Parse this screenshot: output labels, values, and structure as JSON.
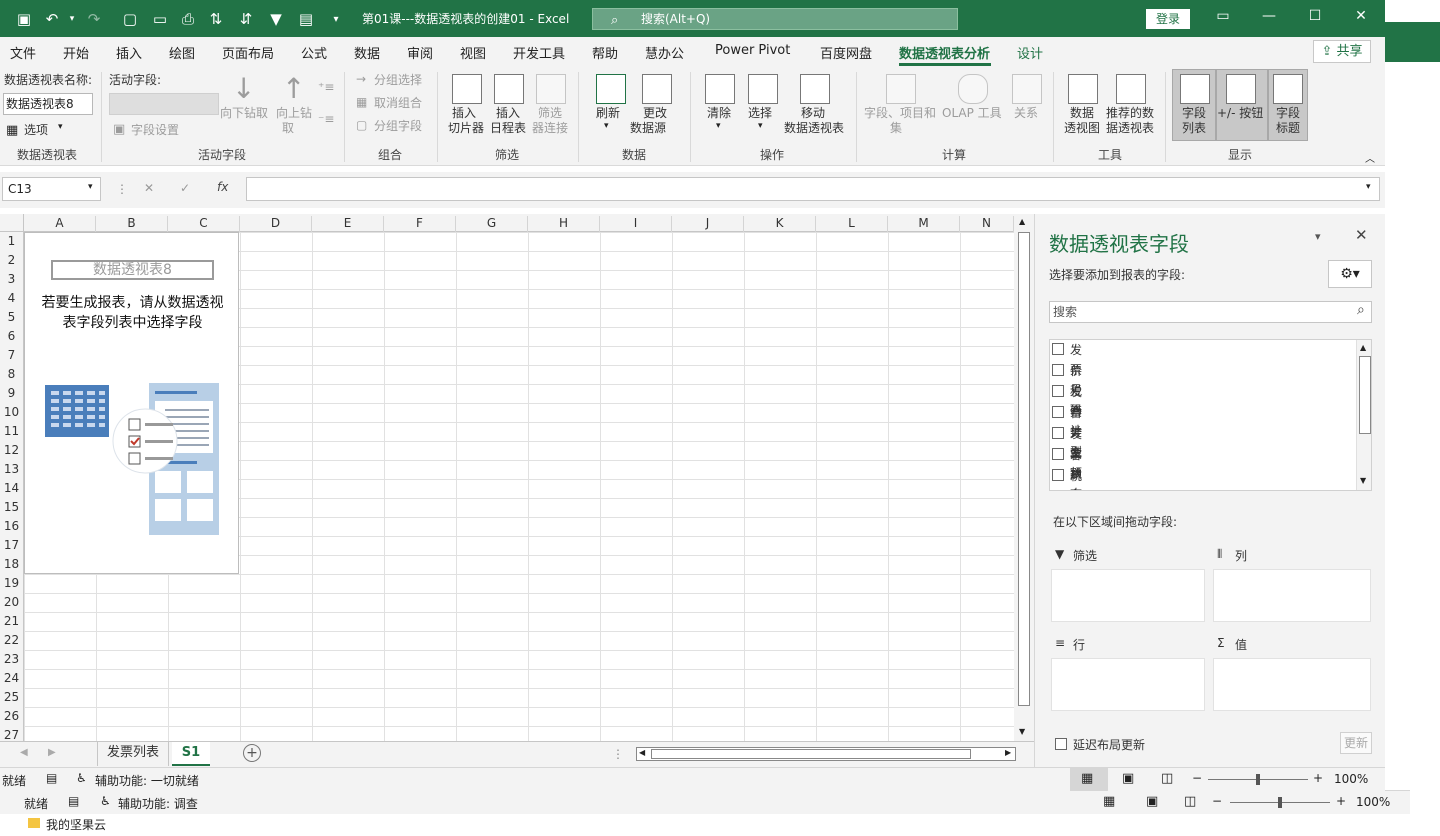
{
  "titlebar": {
    "doc_title": "第01课---数据透视表的创建01  -  Excel",
    "search_placeholder": "搜索(Alt+Q)",
    "login": "登录"
  },
  "menu": {
    "items": [
      "文件",
      "开始",
      "插入",
      "绘图",
      "页面布局",
      "公式",
      "数据",
      "审阅",
      "视图",
      "开发工具",
      "帮助",
      "慧办公",
      "Power Pivot",
      "百度网盘",
      "数据透视表分析",
      "设计"
    ],
    "active": "数据透视表分析",
    "share": "共享"
  },
  "ribbon": {
    "pivot_name_label": "数据透视表名称:",
    "pivot_name_value": "数据透视表8",
    "options": "选项",
    "group_pivot": "数据透视表",
    "active_field_label": "活动字段:",
    "field_settings": "字段设置",
    "drill_down": "向下钻取",
    "drill_up_1": "向上钻",
    "drill_up_2": "取",
    "group_active": "活动字段",
    "group_selection": "分组选择",
    "ungroup": "取消组合",
    "group_field": "分组字段",
    "group_group": "组合",
    "insert_slicer_1": "插入",
    "insert_slicer_2": "切片器",
    "insert_timeline_1": "插入",
    "insert_timeline_2": "日程表",
    "filter_conn_1": "筛选",
    "filter_conn_2": "器连接",
    "group_filter": "筛选",
    "refresh": "刷新",
    "change_src_1": "更改",
    "change_src_2": "数据源",
    "group_data": "数据",
    "clear": "清除",
    "select": "选择",
    "move_1": "移动",
    "move_2": "数据透视表",
    "group_actions": "操作",
    "fields_items_1": "字段、项目和",
    "fields_items_2": "集",
    "olap_1": "OLAP 工具",
    "relations": "关系",
    "group_calc": "计算",
    "pivot_chart_1": "数据",
    "pivot_chart_2": "透视图",
    "recommend_1": "推荐的数",
    "recommend_2": "据透视表",
    "group_tools": "工具",
    "field_list_1": "字段",
    "field_list_2": "列表",
    "buttons": "+/- 按钮",
    "field_headers_1": "字段",
    "field_headers_2": "标题",
    "group_show": "显示"
  },
  "formula": {
    "name_box": "C13",
    "cancel": "✕",
    "enter": "✓",
    "fx": "fx",
    "content": ""
  },
  "sheet": {
    "columns": [
      "A",
      "B",
      "C",
      "D",
      "E",
      "F",
      "G",
      "H",
      "I",
      "J",
      "K",
      "L",
      "M",
      "N"
    ],
    "rows": [
      "1",
      "2",
      "3",
      "4",
      "5",
      "6",
      "7",
      "8",
      "9",
      "10",
      "11",
      "12",
      "13",
      "14",
      "15",
      "16",
      "17",
      "18",
      "19",
      "20",
      "21",
      "22",
      "23",
      "24",
      "25",
      "26",
      "27"
    ],
    "pt_name": "数据透视表8",
    "pt_hint_1": "若要生成报表，请从数据透视",
    "pt_hint_2": "表字段列表中选择字段"
  },
  "tabs": {
    "sheets": [
      "发票列表",
      "S1"
    ],
    "active": "S1"
  },
  "status": {
    "ready": "就绪",
    "accessibility": "辅助功能: 一切就绪",
    "zoom": "100%",
    "bg_ready": "就绪",
    "bg_accessibility": "辅助功能: 调查",
    "bg_zoom": "100%",
    "bg_folder": "我的坚果云"
  },
  "pivot_pane": {
    "title": "数据透视表字段",
    "subtitle": "选择要添加到报表的字段:",
    "search_placeholder": "搜索",
    "fields": [
      "发票号码",
      "价税合计",
      "发票类型",
      "合计金额",
      "发票状态",
      "客户名称",
      "税额"
    ],
    "drag_hint": "在以下区域间拖动字段:",
    "areas": {
      "filter": "筛选",
      "columns": "列",
      "rows": "行",
      "values": "值"
    },
    "defer": "延迟布局更新",
    "update": "更新"
  },
  "colors": {
    "accent": "#217346",
    "ribbon_bg": "#f3f3f3"
  }
}
